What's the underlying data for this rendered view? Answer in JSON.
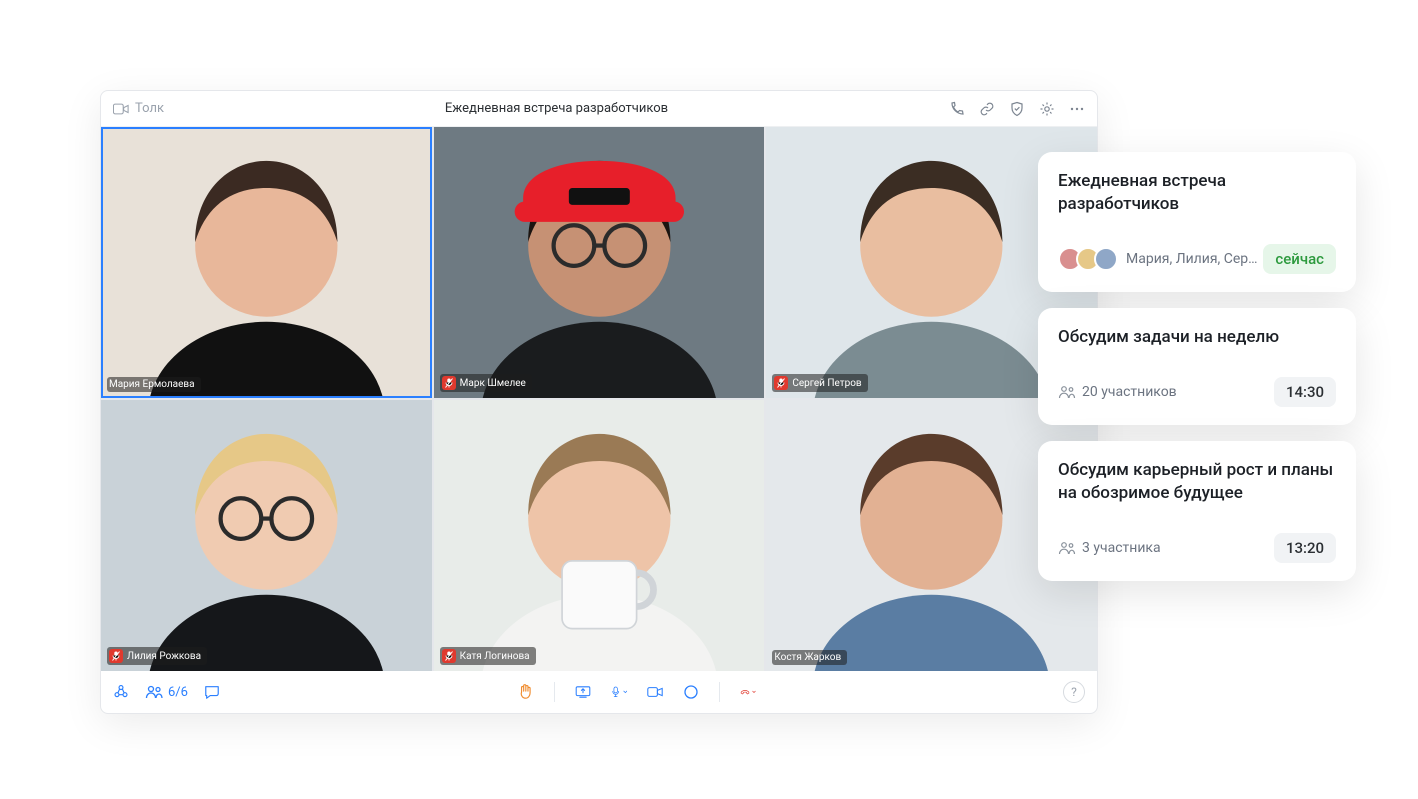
{
  "brand": "Толк",
  "meeting_title": "Ежедневная встреча разработчиков",
  "participant_count_label": "6/6",
  "tiles": [
    {
      "name": "Мария Ермолаева",
      "active": true,
      "muted": false,
      "bg": "#e8e1d8",
      "skin": "#e8b79a",
      "hair": "#3b2a22",
      "shirt": "#111111"
    },
    {
      "name": "Марк Шмелее",
      "active": false,
      "muted": true,
      "bg": "#6e7a82",
      "skin": "#c69174",
      "hair": "#1b1410",
      "shirt": "#1a1c1e",
      "hat": "#e71f2a"
    },
    {
      "name": "Сергей Петров",
      "active": false,
      "muted": true,
      "bg": "#dfe6ea",
      "skin": "#e9bea0",
      "hair": "#3b2d23",
      "shirt": "#7b8c92"
    },
    {
      "name": "Лилия Рожкова",
      "active": false,
      "muted": true,
      "bg": "#c9d2d8",
      "skin": "#f0cbb1",
      "hair": "#e6c887",
      "shirt": "#15171a"
    },
    {
      "name": "Катя Логинова",
      "active": false,
      "muted": true,
      "bg": "#e8ece9",
      "skin": "#eec4a8",
      "hair": "#9a7a55",
      "shirt": "#f3f3f2",
      "cup": true
    },
    {
      "name": "Костя Жарков",
      "active": false,
      "muted": false,
      "bg": "#e4e8eb",
      "skin": "#e2b193",
      "hair": "#5a3c2b",
      "shirt": "#5a7da3"
    }
  ],
  "cards": [
    {
      "title": "Ежедневная встреча разработчиков",
      "attendees_text": "Мария, Лилия, Сер…",
      "time": "сейчас",
      "time_is_now": true,
      "show_avatars": true
    },
    {
      "title": "Обсудим задачи на неделю",
      "participants": "20 участников",
      "time": "14:30"
    },
    {
      "title": "Обсудим карьерный рост и планы на обозримое будущее",
      "participants": "3 участника",
      "time": "13:20"
    }
  ],
  "help_label": "?",
  "colors": {
    "accent_blue": "#2a7fff",
    "hangup_red": "#e0392e",
    "hand_orange": "#f08c2e"
  }
}
